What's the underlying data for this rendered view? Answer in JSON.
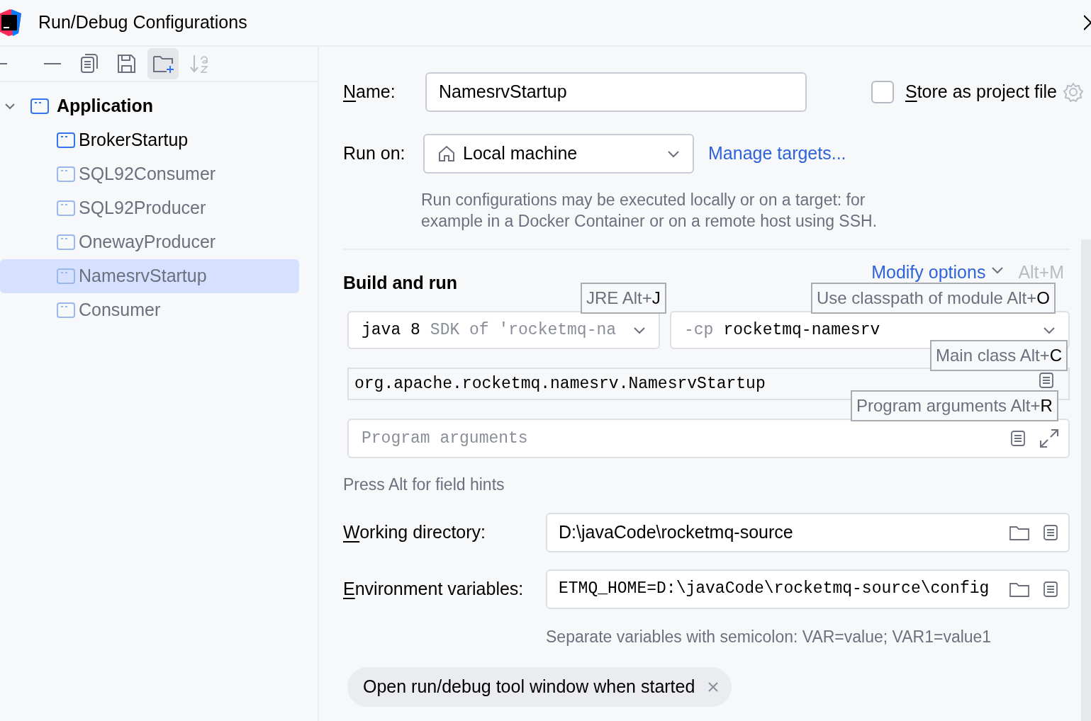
{
  "window": {
    "title": "Run/Debug Configurations"
  },
  "toolbar": [
    {
      "kind": "dash",
      "highlighted": false,
      "disabled": false
    },
    {
      "kind": "remove",
      "highlighted": false,
      "disabled": false
    },
    {
      "kind": "copy",
      "highlighted": false,
      "disabled": false
    },
    {
      "kind": "save",
      "highlighted": false,
      "disabled": false
    },
    {
      "kind": "new-folder",
      "highlighted": true,
      "disabled": false
    },
    {
      "kind": "sort",
      "highlighted": false,
      "disabled": true
    }
  ],
  "tree": [
    {
      "label": "Application",
      "expanded": true,
      "selected": false,
      "children": [
        {
          "label": "BrokerStartup",
          "selected": false,
          "temporary": false
        },
        {
          "label": "SQL92Consumer",
          "selected": false,
          "temporary": true
        },
        {
          "label": "SQL92Producer",
          "selected": false,
          "temporary": true
        },
        {
          "label": "OnewayProducer",
          "selected": false,
          "temporary": true
        },
        {
          "label": "NamesrvStartup",
          "selected": true,
          "temporary": true
        },
        {
          "label": "Consumer",
          "selected": false,
          "temporary": true
        }
      ]
    }
  ],
  "form": {
    "name": {
      "label": "Name:",
      "value": "NamesrvStartup"
    },
    "store": {
      "label": "Store as project file",
      "checked": false
    },
    "run_on": {
      "label": "Run on:",
      "value": "Local machine"
    },
    "manage_targets": "Manage targets...",
    "description": [
      "Run configurations may be executed locally or on a target: for",
      "example in a Docker Container or on a remote host using SSH."
    ],
    "build_title": "Build and run",
    "modify_options": "Modify options",
    "modify_shortcut": "Alt+M",
    "jre": {
      "value": "java 8",
      "hint": "SDK of 'rocketmq-na"
    },
    "classpath": {
      "prefix": "-cp",
      "value": "rocketmq-namesrv"
    },
    "main_class": "org.apache.rocketmq.namesrv.NamesrvStartup",
    "program_args": {
      "placeholder": "Program arguments"
    },
    "field_hints": "Press Alt for field hints",
    "working_dir": {
      "label": "Working directory:",
      "value": "D:\\javaCode\\rocketmq-source"
    },
    "env": {
      "label": "Environment variables:",
      "value": "ETMQ_HOME=D:\\javaCode\\rocketmq-source\\config"
    },
    "env_hint": "Separate variables with semicolon: VAR=value; VAR1=value1",
    "chip": "Open run/debug tool window when started"
  },
  "hints": [
    {
      "label": "JRE Alt+",
      "key": "J"
    },
    {
      "label": "Use classpath of module Alt+",
      "key": "O"
    },
    {
      "label": "Main class Alt+",
      "key": "C"
    },
    {
      "label": "Program arguments Alt+",
      "key": "R"
    }
  ]
}
